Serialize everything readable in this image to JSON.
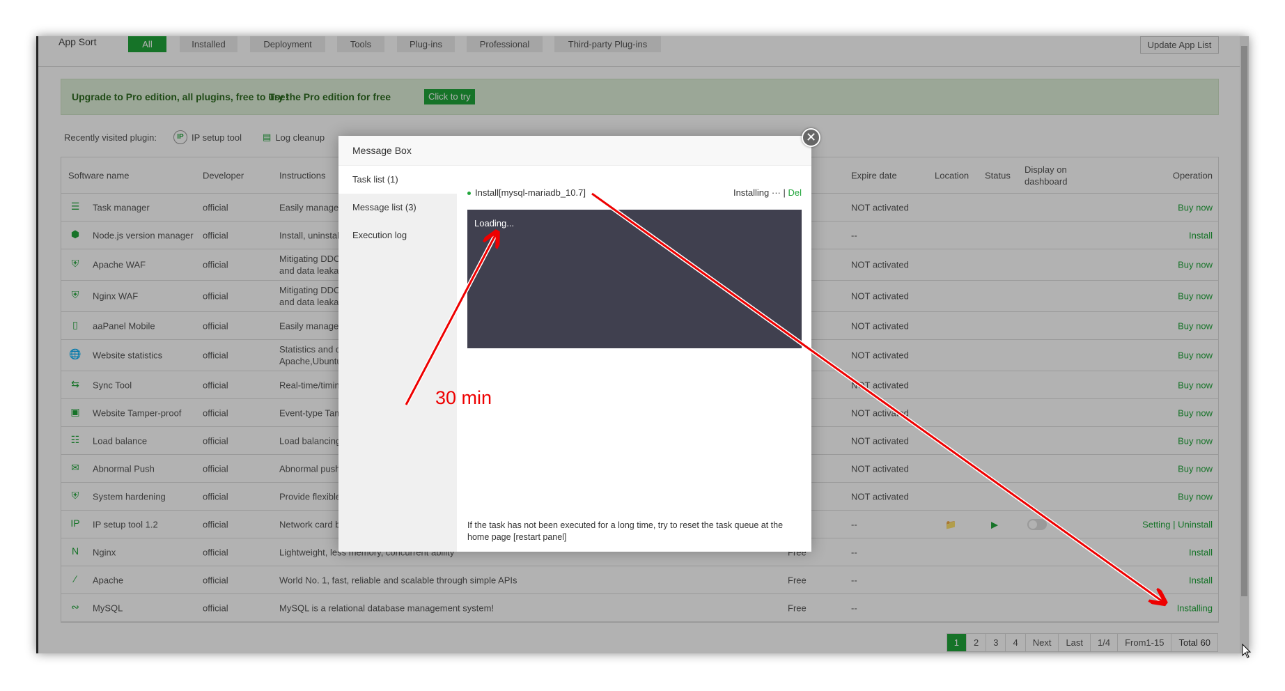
{
  "header": {
    "title": "App Sort",
    "tabs": [
      "All",
      "Installed",
      "Deployment",
      "Tools",
      "Plug-ins",
      "Professional",
      "Third-party Plug-ins"
    ],
    "update_label": "Update App List"
  },
  "banner": {
    "text": "Upgrade to Pro edition, all plugins, free to use!",
    "try_text": "Try the Pro edition for free",
    "button": "Click to try"
  },
  "recent": {
    "label": "Recently visited plugin:",
    "items": [
      "IP setup tool",
      "Log cleanup"
    ]
  },
  "table": {
    "columns": [
      "Software name",
      "Developer",
      "Instructions",
      "Expire date",
      "Location",
      "Status",
      "Display on dashboard",
      "Operation"
    ],
    "rows": [
      {
        "name": "Task manager",
        "dev": "official",
        "ins": "Easily manage p",
        "price": "",
        "exp": "NOT activated",
        "op": "Buy now",
        "icon": "list-icon"
      },
      {
        "name": "Node.js version manager",
        "dev": "official",
        "ins": "Install, uninstall",
        "price": "",
        "exp": "--",
        "op": "Install",
        "icon": "nodejs-icon"
      },
      {
        "name": "Apache WAF",
        "dev": "official",
        "ins": "Mitigating DDC\nand data leakag",
        "price": "",
        "exp": "NOT activated",
        "op": "Buy now",
        "icon": "waf-shield-icon"
      },
      {
        "name": "Nginx WAF",
        "dev": "official",
        "ins": "Mitigating DDC\nand data leakag",
        "price": "",
        "exp": "NOT activated",
        "op": "Buy now",
        "icon": "waf-shield-icon"
      },
      {
        "name": "aaPanel Mobile",
        "dev": "official",
        "ins": "Easily manage y",
        "price": "",
        "exp": "NOT activated",
        "op": "Buy now",
        "icon": "mobile-app-icon"
      },
      {
        "name": "Website statistics",
        "dev": "official",
        "ins": "Statistics and c\nApache,Ubuntu",
        "price": "",
        "exp": "NOT activated",
        "op": "Buy now",
        "icon": "globe-stats-icon"
      },
      {
        "name": "Sync Tool",
        "dev": "official",
        "ins": "Real-time/timin",
        "price": "",
        "exp": "NOT activated",
        "op": "Buy now",
        "icon": "sync-folder-icon"
      },
      {
        "name": "Website Tamper-proof",
        "dev": "official",
        "ins": "Event-type Tam",
        "price": "",
        "exp": "NOT activated",
        "op": "Buy now",
        "icon": "browser-lock-icon"
      },
      {
        "name": "Load balance",
        "dev": "official",
        "ins": "Load balancing",
        "price": "",
        "exp": "NOT activated",
        "op": "Buy now",
        "icon": "network-icon"
      },
      {
        "name": "Abnormal Push",
        "dev": "official",
        "ins": "Abnormal push",
        "price": "",
        "exp": "NOT activated",
        "op": "Buy now",
        "icon": "mail-push-icon"
      },
      {
        "name": "System hardening",
        "dev": "official",
        "ins": "Provide flexible",
        "price": "",
        "exp": "NOT activated",
        "op": "Buy now",
        "icon": "shield-lock-icon"
      },
      {
        "name": "IP setup tool 1.2",
        "dev": "official",
        "ins": "Network card b",
        "price": "",
        "exp": "--",
        "op": "Setting | Uninstall",
        "icon": "ip-icon",
        "installed": true
      },
      {
        "name": "Nginx",
        "dev": "official",
        "ins": "Lightweight, less memory, concurrent ability",
        "price": "Free",
        "exp": "--",
        "op": "Install",
        "icon": "nginx-icon"
      },
      {
        "name": "Apache",
        "dev": "official",
        "ins": "World No. 1, fast, reliable and scalable through simple APIs",
        "price": "Free",
        "exp": "--",
        "op": "Install",
        "icon": "apache-feather-icon"
      },
      {
        "name": "MySQL",
        "dev": "official",
        "ins": "MySQL is a relational database management system!",
        "price": "Free",
        "exp": "--",
        "op": "Installing",
        "icon": "mysql-dolphin-icon"
      }
    ]
  },
  "pager": {
    "pages": [
      "1",
      "2",
      "3",
      "4"
    ],
    "next": "Next",
    "last": "Last",
    "ratio": "1/4",
    "range": "From1-15",
    "total": "Total 60"
  },
  "dialog": {
    "title": "Message Box",
    "tabs": [
      "Task list (1)",
      "Message list (3)",
      "Execution log"
    ],
    "task": "Install[mysql-mariadb_10.7]",
    "status": "Installing ···",
    "sep": " | ",
    "del": "Del",
    "console": "Loading...",
    "note": "If the task has not been executed for a long time, try to reset the task queue at the home page [restart panel]"
  },
  "annotation": {
    "text": "30 min",
    "color": "#e00000"
  },
  "colors": {
    "accent": "#20a53a"
  }
}
